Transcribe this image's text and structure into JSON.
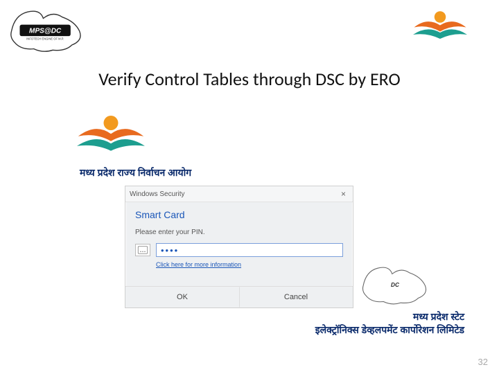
{
  "title": "Verify Control Tables through DSC by ERO",
  "hindi": {
    "sec_label": "मध्य प्रदेश राज्य निर्वाचन आयोग",
    "mpsedc_line1": "मध्य प्रदेश स्टेट",
    "mpsedc_line2": "इलेक्ट्रॉनिक्स डेव्हलपमेंट कार्पोरेशन लिमिटेड"
  },
  "dialog": {
    "titlebar": "Windows Security",
    "close": "×",
    "heading": "Smart Card",
    "prompt": "Please enter your PIN.",
    "pin_masked": "••••",
    "more_info": "Click here for more information",
    "ok": "OK",
    "cancel": "Cancel"
  },
  "icons": {
    "mpsedc_alt": "MPSeDC",
    "sec_alt": "SEC MP",
    "card_alt": "PIN"
  },
  "slide_number": "32"
}
